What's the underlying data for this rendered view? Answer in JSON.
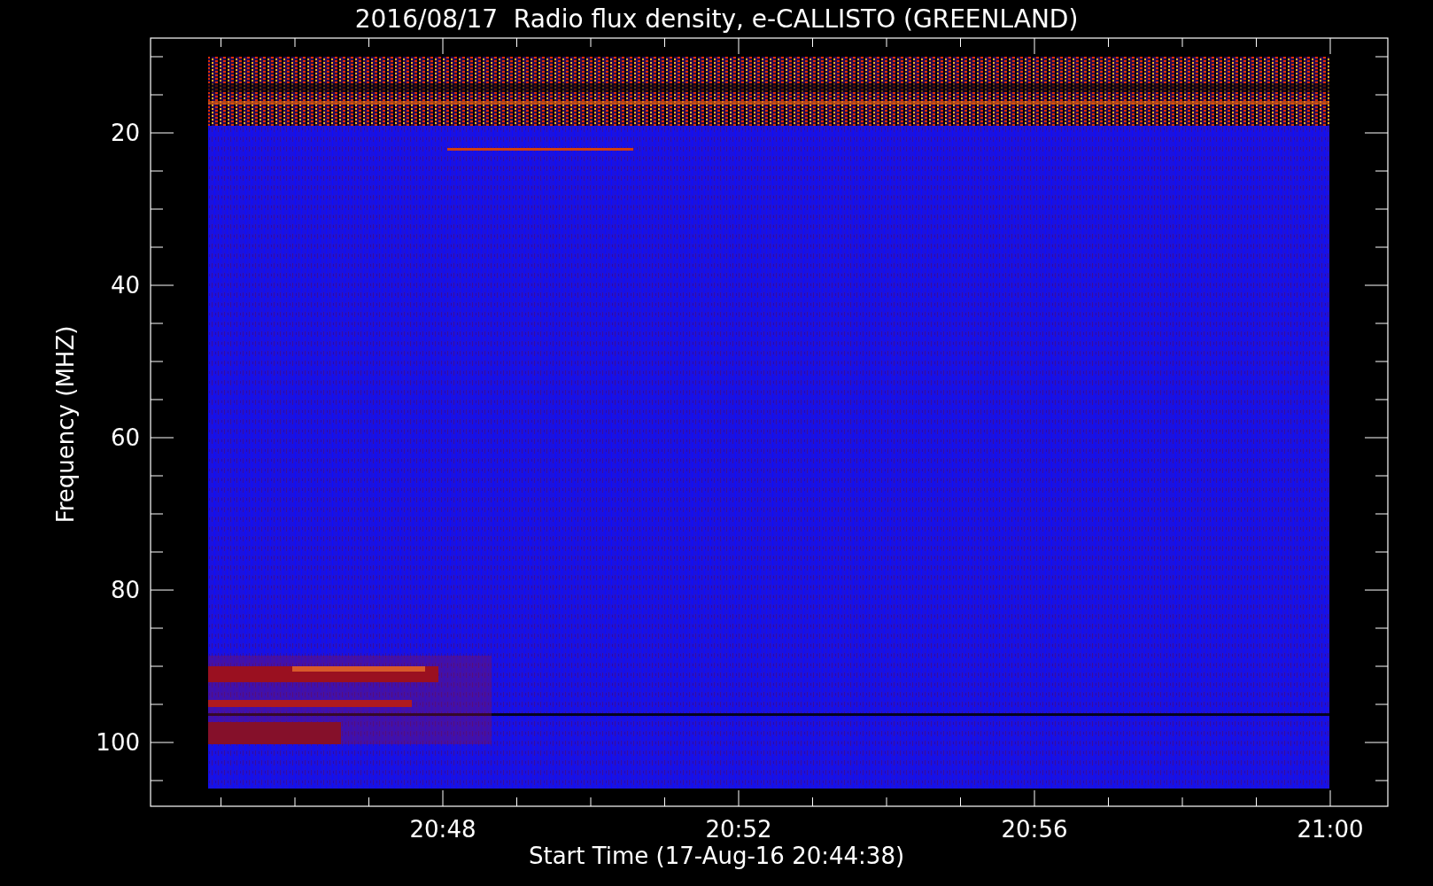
{
  "title": "2016/08/17  Radio flux density, e-CALLISTO (GREENLAND)",
  "y_axis": {
    "label": "Frequency (MHZ)",
    "ticks": [
      "20",
      "40",
      "60",
      "80",
      "100"
    ]
  },
  "x_axis": {
    "label": "Start Time (17-Aug-16 20:44:38)",
    "ticks": [
      "20:48",
      "20:52",
      "20:56",
      "21:00"
    ]
  }
}
